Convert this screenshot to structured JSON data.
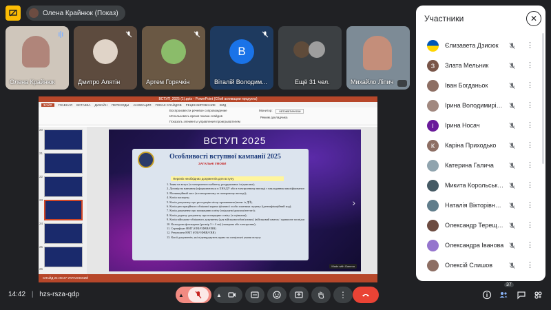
{
  "presenter_chip": {
    "label": "Олена Крайнюк (Показ)"
  },
  "tiles": [
    {
      "name": "Олена Крайнюк"
    },
    {
      "name": "Дмитро Алятін"
    },
    {
      "name": "Артем Горячкін"
    },
    {
      "name": "Віталій Володим...",
      "initial": "В"
    },
    {
      "name": "Ещё 31 чел."
    },
    {
      "name": "Михайло Ліпич"
    }
  ],
  "powerpoint": {
    "title_bar": "ВСТУП_2025 (1).pptx - PowerPoint (Сбой активации продукта)",
    "tabs": [
      "ФАЙЛ",
      "ГЛАВНАЯ",
      "ВСТАВКА",
      "ДИЗАЙН",
      "ПЕРЕХОДЫ",
      "АНИМАЦИЯ",
      "ПОКАЗ СЛАЙДОВ",
      "РЕЦЕНЗИРОВАНИЕ",
      "ВИД"
    ],
    "ribbon_options": [
      "Воспроизвести речевое сопровождение",
      "Использовать время показа слайдов",
      "Показать элементы управления проигрывателем",
      "Монитор:",
      "Автоматически",
      "Режим докладчика"
    ],
    "status_bar": "СЛАЙД 24 ИЗ 27     УКРАИНСКИЙ",
    "thumb_numbers": [
      "20",
      "21",
      "22",
      "23",
      "24",
      "25",
      "26"
    ]
  },
  "slide": {
    "title": "ВСТУП 2025",
    "card_heading": "Особливості вступної кампанії 2025",
    "card_subheading": "ЗАГАЛЬНІ УМОВИ",
    "highlight": "Перелік необхідних документів для вступу",
    "items": [
      "1. Заява на вступ (з електронного кабінету, роздрукована і підписана);",
      "2. Договір на навчання (оформлюються в ХНАДУ або в електронному вигляді з накладанням кваліфікованого електронного підпису);",
      "3. Мотиваційний лист (в електронному та паперовому вигляді);",
      "4. Копія паспорту;",
      "5. Копія документу про реєстрацію місця проживання (витяг із ДІЇ);",
      "6. Копія реєстраційного облікової картки фізичної особи платника податку (ідентифікаційний код);",
      "7. Копія документу про попередню освіту (свідоцтво/диплом/атестат);",
      "8. Копія додатку документу про попередню освіту (з оцінками);",
      "9. Копія військово-облікового документу (для військовозобов'язаних) (військовий квиток / приписне посвідчення / тимчасове посвідчення / Резерв+);",
      "10. Кольорова фотокартка (розмір 3 × 4 см) (паперова або електронна);",
      "11. Сертифікат НМТ (ЄВІ/ЄФВВ/ЄВВ)",
      "12. Результати НМТ (ЄВІ/ЄФВВ/ЄВВ)",
      "13. Копії документів, які підтверджують право на спеціальні умови вступу"
    ],
    "badge": "Made with Gamma"
  },
  "participants": {
    "title": "Участники",
    "list": [
      {
        "name": "Єлизавета Дзисюк",
        "avatar": "flag",
        "color": "#ffd500"
      },
      {
        "name": "Злата Мельник",
        "initial": "З",
        "color": "#795548"
      },
      {
        "name": "Іван Богданьок",
        "avatar": "photo",
        "color": "#8d6e63"
      },
      {
        "name": "Ірина Володимирівна ...",
        "avatar": "photo",
        "color": "#a1887f"
      },
      {
        "name": "Ірина Носач",
        "initial": "І",
        "color": "#6a1b9a"
      },
      {
        "name": "Каріна Приходько",
        "initial": "К",
        "color": "#8d6e63"
      },
      {
        "name": "Катерина Галича",
        "avatar": "photo",
        "color": "#90a4ae"
      },
      {
        "name": "Микита Корольський",
        "avatar": "photo",
        "color": "#455a64"
      },
      {
        "name": "Наталія Вікторівна Вис...",
        "avatar": "photo",
        "color": "#607d8b"
      },
      {
        "name": "Олександр Терещенко",
        "avatar": "photo",
        "color": "#6d4c41"
      },
      {
        "name": "Олександра Іванова",
        "avatar": "blank",
        "color": "#9575cd"
      },
      {
        "name": "Олексій Слишов",
        "avatar": "photo",
        "color": "#8d6e63"
      }
    ]
  },
  "bottom": {
    "time": "14:42",
    "meeting_code": "hzs-rsza-qdp",
    "participant_count": "37"
  }
}
